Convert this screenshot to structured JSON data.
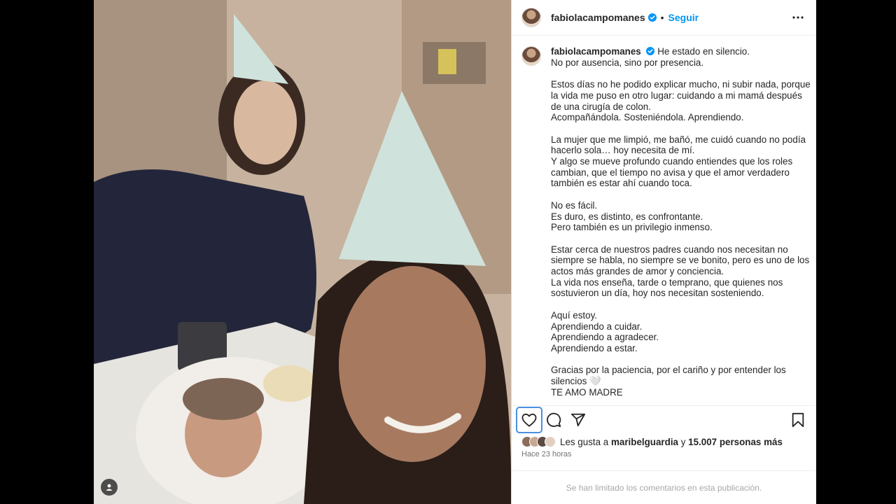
{
  "post": {
    "username": "fabiolacampomanes",
    "dot": "•",
    "follow_label": "Seguir",
    "caption_first": "He estado en silencio.",
    "caption_lines": [
      "No por ausencia, sino por presencia.",
      "",
      "Estos días no he podido explicar mucho, ni subir nada, porque",
      "la vida me puso en otro lugar: cuidando a mi mamá después",
      "de una cirugía de colon.",
      "Acompañándola. Sosteniéndola. Aprendiendo.",
      "",
      "La mujer que me limpió, me bañó, me cuidó cuando no podía",
      "hacerlo sola… hoy necesita de mí.",
      "Y algo se mueve profundo cuando entiendes que los roles",
      "cambian, que el tiempo no avisa y que el amor verdadero",
      "también es estar ahí cuando toca.",
      "",
      "No es fácil.",
      "Es duro, es distinto, es confrontante.",
      "Pero también es un privilegio inmenso.",
      "",
      "Estar cerca de nuestros padres cuando nos necesitan no",
      "siempre se habla, no siempre se ve bonito, pero es uno de los",
      "actos más grandes de amor y conciencia.",
      "La vida nos enseña, tarde o temprano, que quienes nos",
      "sostuvieron un día, hoy nos necesitan sosteniendo.",
      "",
      "Aquí estoy.",
      "Aprendiendo a cuidar.",
      "Aprendiendo a agradecer.",
      "Aprendiendo a estar.",
      "",
      "Gracias por la paciencia, por el cariño y por entender los",
      "silencios 🤍",
      "TE AMO MADRE"
    ],
    "likes_prefix": "Les gusta a",
    "likes_user": "maribelguardia",
    "likes_conj": "y",
    "likes_count": "15.007 personas más",
    "time_ago": "Hace 23 horas",
    "comments_limited": "Se han limitado los comentarios en esta publicación."
  },
  "icons": {
    "verified": "verified-badge-icon",
    "more": "more-options-icon",
    "like": "heart-icon",
    "comment": "comment-icon",
    "share": "share-icon",
    "save": "bookmark-icon",
    "tag": "user-tag-icon"
  },
  "colors": {
    "accent": "#0095f6",
    "text": "#262626",
    "muted": "#737373",
    "background": "#000000"
  }
}
